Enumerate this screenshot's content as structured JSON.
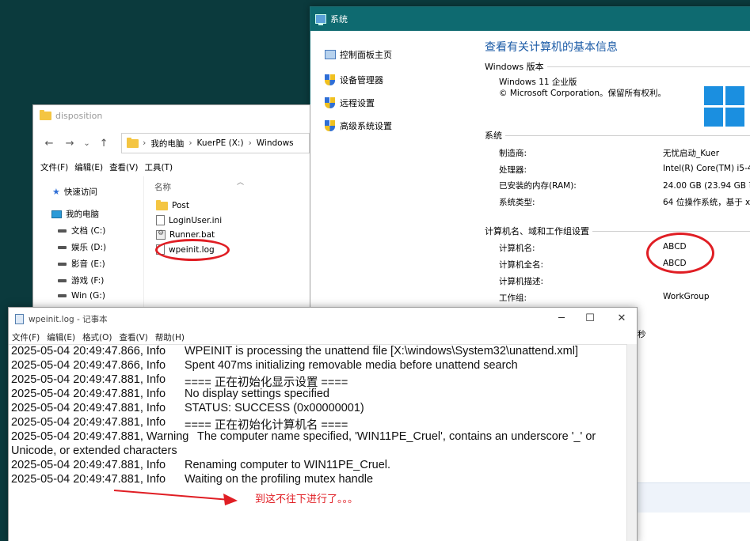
{
  "system": {
    "title": "系统",
    "left_links": [
      "控制面板主页",
      "设备管理器",
      "远程设置",
      "高级系统设置"
    ],
    "heading": "查看有关计算机的基本信息",
    "edition_section": "Windows 版本",
    "edition_name": "Windows 11 企业版",
    "copyright": "© Microsoft Corporation。保留所有权利。",
    "system_section": "系统",
    "system_rows": [
      {
        "label": "制造商:",
        "value": "无忧启动_Kuer"
      },
      {
        "label": "处理器:",
        "value": "Intel(R) Core(TM) i5-4"
      },
      {
        "label": "已安装的内存(RAM):",
        "value": "24.00 GB (23.94 GB 可"
      },
      {
        "label": "系统类型:",
        "value": "64 位操作系统，基于 x6"
      }
    ],
    "computer_section": "计算机名、域和工作组设置",
    "computer_rows": [
      {
        "label": "计算机名:",
        "value": "ABCD"
      },
      {
        "label": "计算机全名:",
        "value": "ABCD"
      },
      {
        "label": "计算机描述:",
        "value": ""
      },
      {
        "label": "工作组:",
        "value": "WorkGroup"
      }
    ],
    "fragment": "1 秒"
  },
  "explorer": {
    "title": "disposition",
    "breadcrumb": [
      "我的电脑",
      "KuerPE (X:)",
      "Windows"
    ],
    "menu": [
      "文件(F)",
      "编辑(E)",
      "查看(V)",
      "工具(T)"
    ],
    "sidebar": {
      "quick_access": "快速访问",
      "this_pc": "我的电脑",
      "drives": [
        "文档 (C:)",
        "娱乐 (D:)",
        "影音 (E:)",
        "游戏 (F:)",
        "Win (G:)"
      ]
    },
    "column_name": "名称",
    "files": [
      "Post",
      "LoginUser.ini",
      "Runner.bat",
      "wpeinit.log"
    ]
  },
  "notepad": {
    "title": "wpeinit.log - 记事本",
    "menu": [
      "文件(F)",
      "编辑(E)",
      "格式(O)",
      "查看(V)",
      "帮助(H)"
    ],
    "lines": [
      {
        "prefix": "2025-05-04 20:49:47.866, Info",
        "message": "WPEINIT is processing the unattend file [X:\\windows\\System32\\unattend.xml]"
      },
      {
        "prefix": "2025-05-04 20:49:47.866, Info",
        "message": "Spent 407ms initializing removable media before unattend search"
      },
      {
        "prefix": "2025-05-04 20:49:47.881, Info",
        "message": "==== 正在初始化显示设置 ===="
      },
      {
        "prefix": "2025-05-04 20:49:47.881, Info",
        "message": "No display settings specified"
      },
      {
        "prefix": "2025-05-04 20:49:47.881, Info",
        "message": "STATUS: SUCCESS (0x00000001)"
      },
      {
        "prefix": "2025-05-04 20:49:47.881, Info",
        "message": "==== 正在初始化计算机名 ===="
      },
      {
        "prefix": "2025-05-04 20:49:47.881, Warning",
        "message": "The computer name specified, 'WIN11PE_Cruel', contains an underscore '_' or"
      },
      {
        "prefix": "Unicode, or extended characters",
        "message": ""
      },
      {
        "prefix": "2025-05-04 20:49:47.881, Info",
        "message": "Renaming computer to WIN11PE_Cruel."
      },
      {
        "prefix": "2025-05-04 20:49:47.881, Info",
        "message": "Waiting on the profiling mutex handle"
      }
    ]
  },
  "annotation": "到这不往下进行了。。。",
  "colors": {
    "accent": "#0e6a70",
    "highlight": "#e01e24",
    "link": "#1a5aa6"
  }
}
